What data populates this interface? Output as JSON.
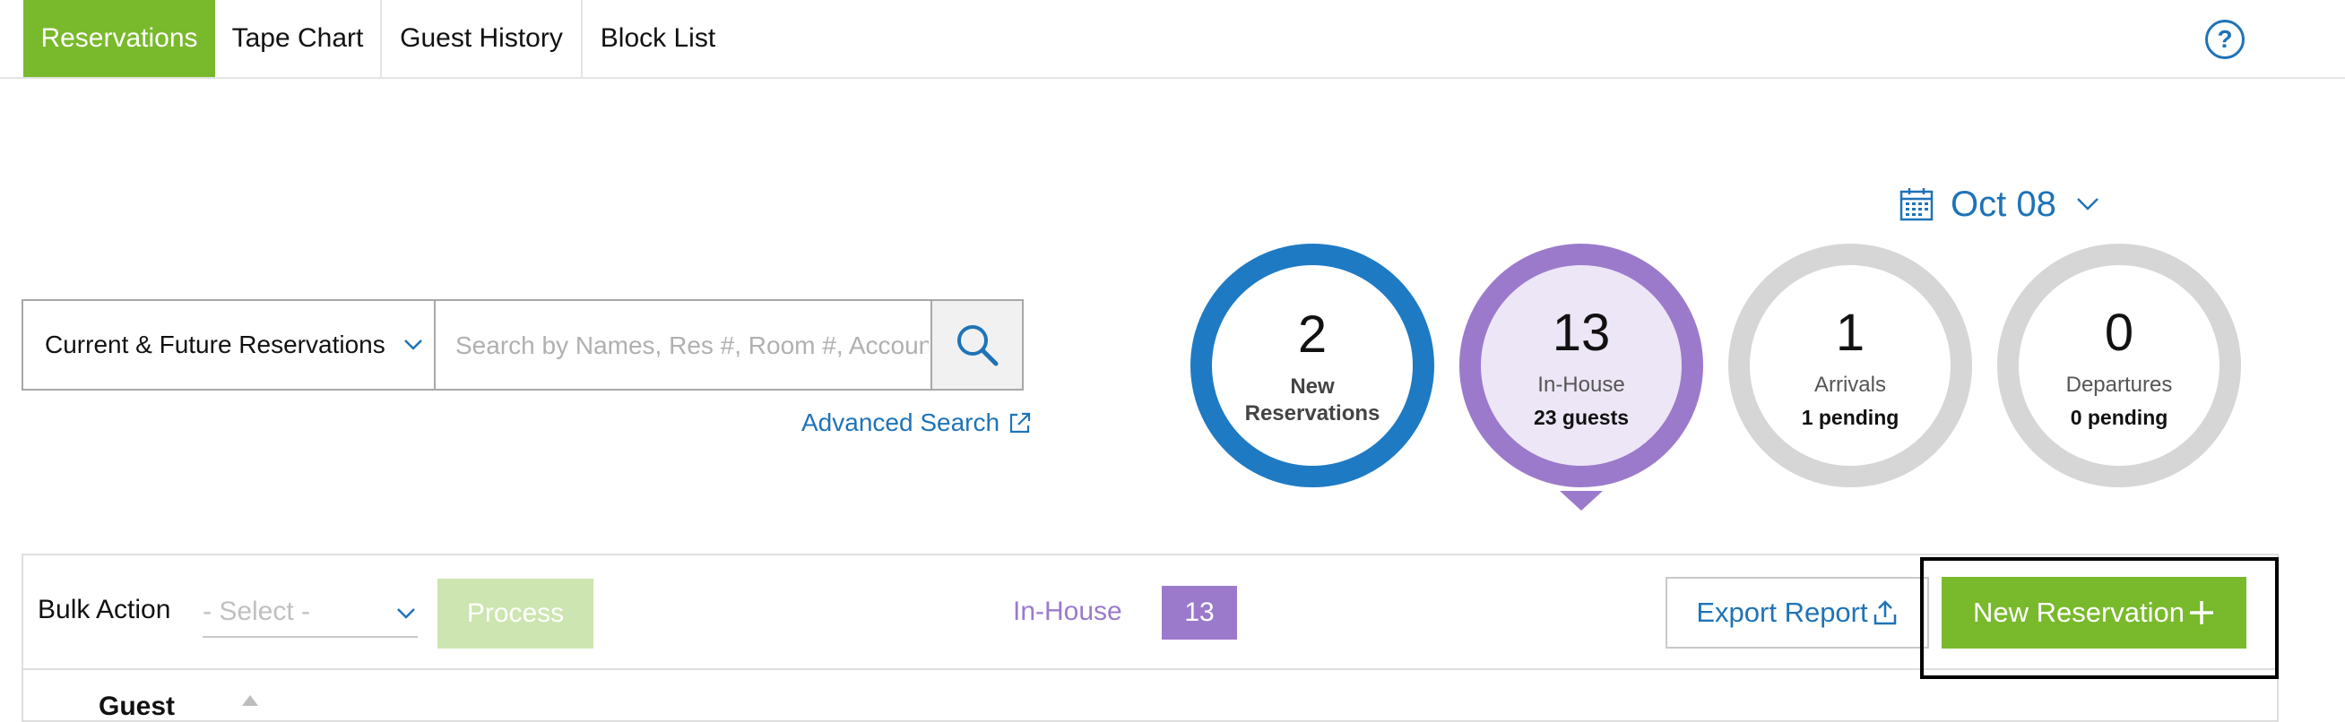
{
  "tabs": [
    {
      "label": "Reservations",
      "active": true
    },
    {
      "label": "Tape Chart",
      "active": false
    },
    {
      "label": "Guest History",
      "active": false
    },
    {
      "label": "Block List",
      "active": false
    }
  ],
  "help": {
    "label": "?"
  },
  "date_picker": {
    "value": "Oct 08",
    "icon": "calendar-icon"
  },
  "search": {
    "filter_value": "Current & Future Reservations",
    "placeholder": "Search by Names, Res #, Room #, Account",
    "value": "",
    "button_icon": "search-icon",
    "advanced_label": "Advanced Search",
    "advanced_icon": "external-link-icon"
  },
  "stats": {
    "new": {
      "count": "2",
      "label_line1": "New",
      "label_line2": "Reservations",
      "color": "#1f7ac4"
    },
    "in_house": {
      "count": "13",
      "label": "In-House",
      "sub": "23 guests",
      "color": "#9b7acb",
      "selected": true
    },
    "arrivals": {
      "count": "1",
      "label": "Arrivals",
      "sub": "1 pending"
    },
    "departures": {
      "count": "0",
      "label": "Departures",
      "sub": "0 pending"
    }
  },
  "actions": {
    "bulk_label": "Bulk Action",
    "bulk_placeholder": "- Select -",
    "process_label": "Process",
    "filter_label": "In-House",
    "filter_count": "13",
    "export_label": "Export Report",
    "new_reservation_label": "New Reservation"
  },
  "table": {
    "first_column_header": "Guest"
  },
  "colors": {
    "accent_green": "#79b92c",
    "link_blue": "#1f73b7",
    "in_house_purple": "#9b7acb"
  }
}
